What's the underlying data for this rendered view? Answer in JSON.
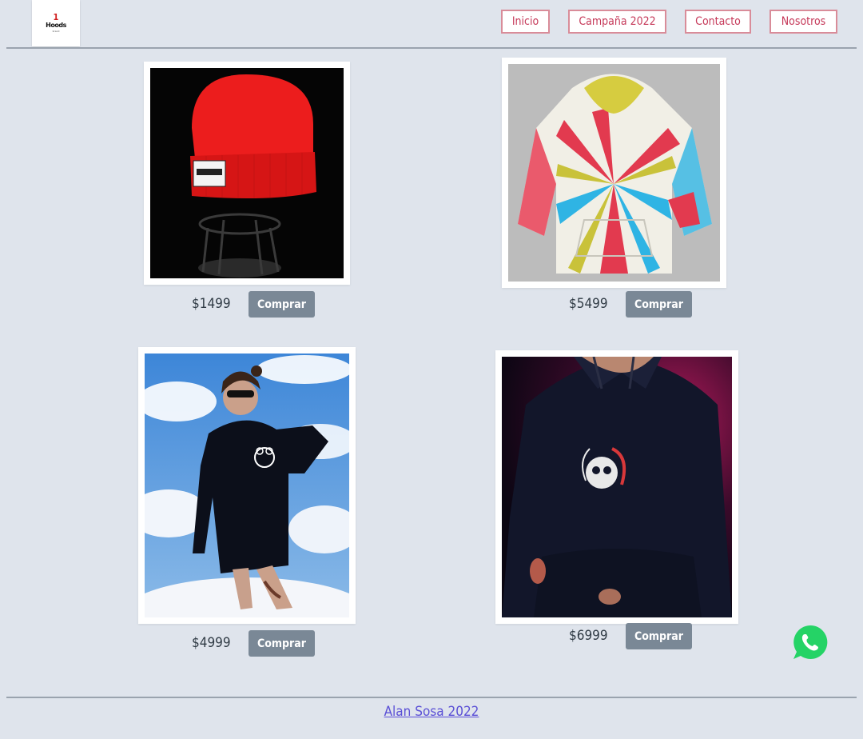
{
  "header": {
    "logo": {
      "number": "1",
      "word": "Hoods",
      "tagline": "brand"
    },
    "nav": [
      {
        "label": "Inicio"
      },
      {
        "label": "Campaña 2022"
      },
      {
        "label": "Contacto"
      },
      {
        "label": "Nosotros"
      }
    ]
  },
  "products": [
    {
      "name": "red-beanie",
      "price": "$1499",
      "buy_label": "Comprar"
    },
    {
      "name": "tie-dye-hoodie",
      "price": "$5499",
      "buy_label": "Comprar"
    },
    {
      "name": "black-bear-hoodie",
      "price": "$4999",
      "buy_label": "Comprar"
    },
    {
      "name": "black-skull-hoodie",
      "price": "$6999",
      "buy_label": "Comprar"
    }
  ],
  "whatsapp": {
    "icon": "whatsapp-icon",
    "color": "#25d366"
  },
  "footer": {
    "link_text": "Alan Sosa 2022",
    "link_color": "#5b50d6"
  }
}
